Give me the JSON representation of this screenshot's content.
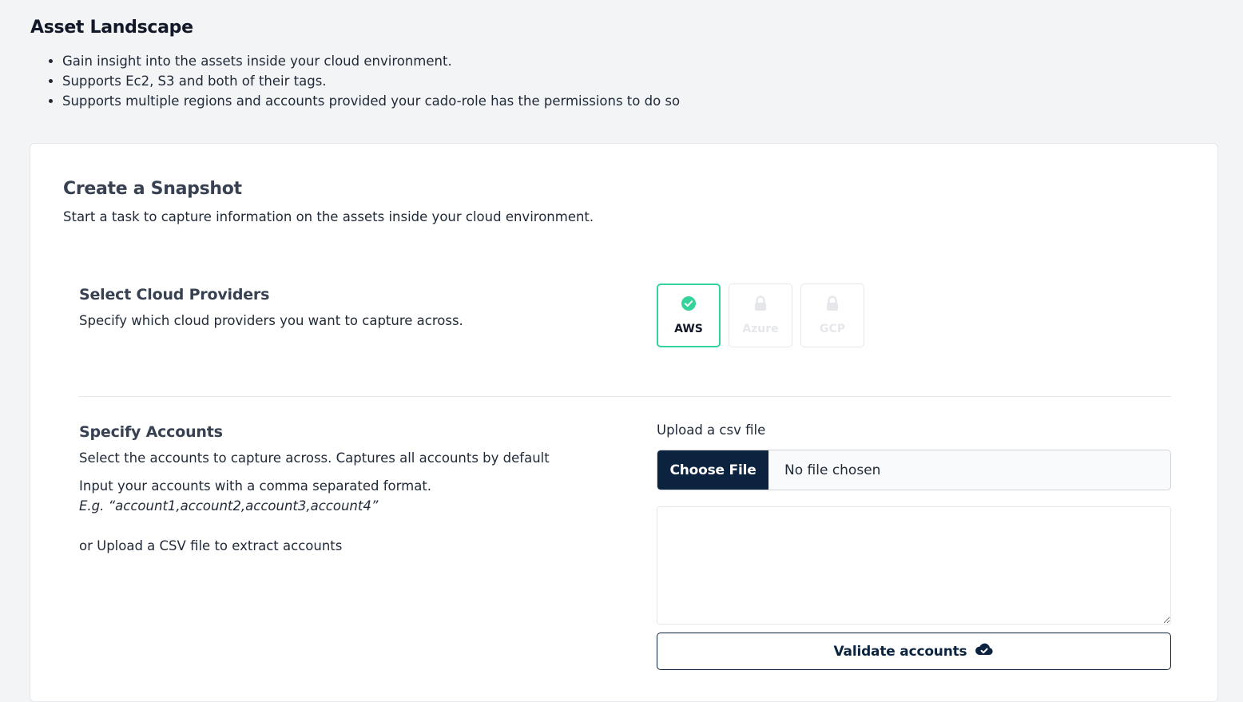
{
  "page": {
    "title": "Asset Landscape",
    "bullets": [
      "Gain insight into the assets inside your cloud environment.",
      "Supports Ec2, S3 and both of their tags.",
      "Supports multiple regions and accounts provided your cado-role has the permissions to do so"
    ]
  },
  "snapshot": {
    "title": "Create a Snapshot",
    "subtitle": "Start a task to capture information on the assets inside your cloud environment."
  },
  "providers_section": {
    "title": "Select Cloud Providers",
    "description": "Specify which cloud providers you want to capture across.",
    "providers": [
      {
        "label": "AWS",
        "icon": "check-circle-icon",
        "state": "selected"
      },
      {
        "label": "Azure",
        "icon": "lock-icon",
        "state": "disabled"
      },
      {
        "label": "GCP",
        "icon": "lock-icon",
        "state": "disabled"
      }
    ]
  },
  "accounts_section": {
    "title": "Specify Accounts",
    "description": "Select the accounts to capture across. Captures all accounts by default",
    "format_hint": "Input your accounts with a comma separated format.",
    "example": "E.g. “account1,account2,account3,account4”",
    "csv_hint": "or Upload a CSV file to extract accounts",
    "upload_label": "Upload a csv file",
    "choose_file_label": "Choose File",
    "file_status": "No file chosen",
    "textarea_value": "",
    "validate_label": "Validate accounts",
    "validate_icon": "cloud-check-icon"
  },
  "colors": {
    "accent_navy": "#0c2340",
    "selected_green": "#34d399",
    "background": "#f3f4f6"
  }
}
